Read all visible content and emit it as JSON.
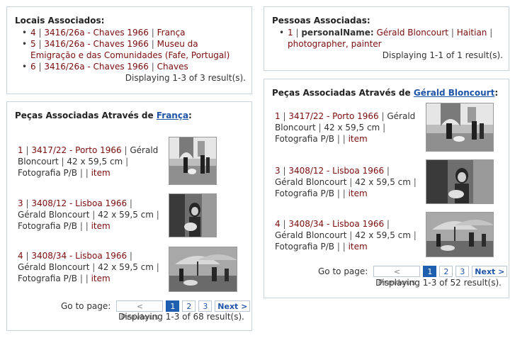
{
  "locais": {
    "title": "Locais Associados:",
    "items": [
      {
        "num": "4",
        "link": "3416/26a - Chaves 1966",
        "place": "França"
      },
      {
        "num": "5",
        "link": "3416/26a - Chaves 1966",
        "place": "Museu da Emigração e das Comunidades (Fafe, Portugal)"
      },
      {
        "num": "6",
        "link": "3416/26a - Chaves 1966",
        "place": "Chaves"
      }
    ],
    "summary": "Displaying 1-3 of 3 result(s)."
  },
  "pessoas": {
    "title": "Pessoas Associadas:",
    "item": {
      "num": "1",
      "field": "personalName:",
      "name": "Gérald Bloncourt",
      "nationality": "Haitian",
      "role": "photographer, painter"
    },
    "summary": "Displaying 1-1 of 1 result(s)."
  },
  "pecas_franca": {
    "title_prefix": "Peças Associadas Através de ",
    "title_link": "França",
    "items": [
      {
        "num": "1",
        "link": "3417/22 - Porto 1966",
        "author": "Gérald Bloncourt",
        "size": "42 x 59,5 cm",
        "type": "Fotografia P/B",
        "item": "item",
        "thumb": "photo-thumb-porto"
      },
      {
        "num": "3",
        "link": "3408/12 - Lisboa 1966",
        "author": "Gérald Bloncourt",
        "size": "42 x 59,5 cm",
        "type": "Fotografia P/B",
        "item": "item",
        "thumb": "photo-thumb-girl"
      },
      {
        "num": "4",
        "link": "3408/34 - Lisboa 1966",
        "author": "Gérald Bloncourt",
        "size": "42 x 59,5 cm",
        "type": "Fotografia P/B",
        "item": "item",
        "thumb": "photo-thumb-market"
      }
    ],
    "pager": {
      "label": "Go to page:",
      "prev": "< Previous",
      "pages": [
        "1",
        "2",
        "3"
      ],
      "next": "Next >",
      "current": "1"
    },
    "summary": "Displaying 1-3 of 68 result(s)."
  },
  "pecas_gerald": {
    "title_prefix": "Peças Associadas Através de ",
    "title_link": "Gérald Bloncourt",
    "items": [
      {
        "num": "1",
        "link": "3417/22 - Porto 1966",
        "author": "Gérald Bloncourt",
        "size": "42 x 59,5 cm",
        "type": "Fotografia P/B",
        "item": "item",
        "thumb": "photo-thumb-porto"
      },
      {
        "num": "3",
        "link": "3408/12 - Lisboa 1966",
        "author": "Gérald Bloncourt",
        "size": "42 x 59,5 cm",
        "type": "Fotografia P/B",
        "item": "item",
        "thumb": "photo-thumb-girl"
      },
      {
        "num": "4",
        "link": "3408/34 - Lisboa 1966",
        "author": "Gérald Bloncourt",
        "size": "42 x 59,5 cm",
        "type": "Fotografia P/B",
        "item": "item",
        "thumb": "photo-thumb-market"
      }
    ],
    "pager": {
      "label": "Go to page:",
      "prev": "< Previous",
      "pages": [
        "1",
        "2",
        "3"
      ],
      "next": "Next >",
      "current": "1"
    },
    "summary": "Displaying 1-3 of 52 result(s)."
  },
  "colors": {
    "link_red": "#7a0c0c",
    "link_blue": "#1f55a8",
    "border": "#c8d3da",
    "active_page": "#1f5fb0"
  }
}
